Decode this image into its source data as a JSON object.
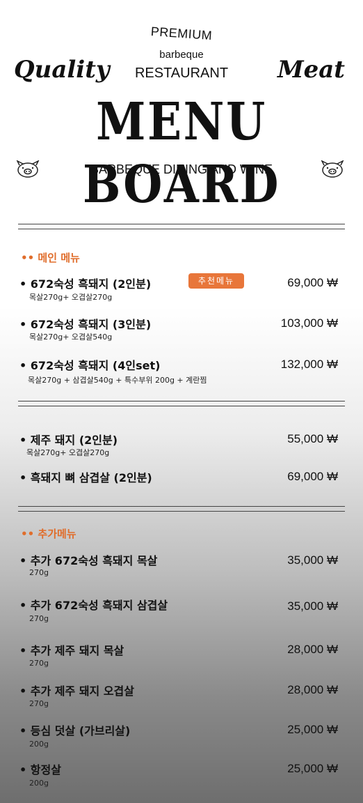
{
  "header": {
    "premium": "PREMIUM",
    "barbeque": "barbeque",
    "restaurant": "RESTAURANT",
    "left_script": "Quality",
    "right_script": "Meat",
    "title": "MENU BOARD",
    "subtitle": "BARBEQUE DINING AND WINE"
  },
  "sections": {
    "main": "•• 메인 메뉴",
    "additional": "•• 추가메뉴"
  },
  "badge": "추천메뉴",
  "items": [
    {
      "name": "• 672숙성 흑돼지 (2인분)",
      "desc": "목살270g+ 오겹살270g",
      "price": "69,000 ₩"
    },
    {
      "name": "• 672숙성 흑돼지 (3인분)",
      "desc": "목살270g+ 오겹살540g",
      "price": "103,000 ₩"
    },
    {
      "name": "• 672숙성 흑돼지 (4인set)",
      "desc": "목살270g + 삼겹살540g + 특수부위 200g + 계란찜",
      "price": "132,000 ₩"
    },
    {
      "name": "• 제주 돼지 (2인분)",
      "desc": "목살270g+ 오겹살270g",
      "price": "55,000 ₩"
    },
    {
      "name": "• 흑돼지 뼈 삼겹살 (2인분)",
      "desc": "",
      "price": "69,000 ₩"
    },
    {
      "name": "• 추가 672숙성 흑돼지 목살",
      "desc": "270g",
      "price": "35,000 ₩"
    },
    {
      "name": "• 추가 672숙성 흑돼지 삼겹살",
      "desc": "270g",
      "price": "35,000 ₩"
    },
    {
      "name": "• 추가 제주 돼지 목살",
      "desc": "270g",
      "price": "28,000 ₩"
    },
    {
      "name": "• 추가 제주 돼지 오겹살",
      "desc": "270g",
      "price": "28,000 ₩"
    },
    {
      "name": "• 등심 덧살 (가브리살)",
      "desc": "200g",
      "price": "25,000 ₩"
    },
    {
      "name": "• 항정살",
      "desc": "200g",
      "price": "25,000 ₩"
    }
  ],
  "icons": {
    "pig_left": "pig-face-icon",
    "pig_right": "pig-face-icon"
  },
  "colors": {
    "accent": "#e06d2b",
    "badge": "#e8763a"
  }
}
